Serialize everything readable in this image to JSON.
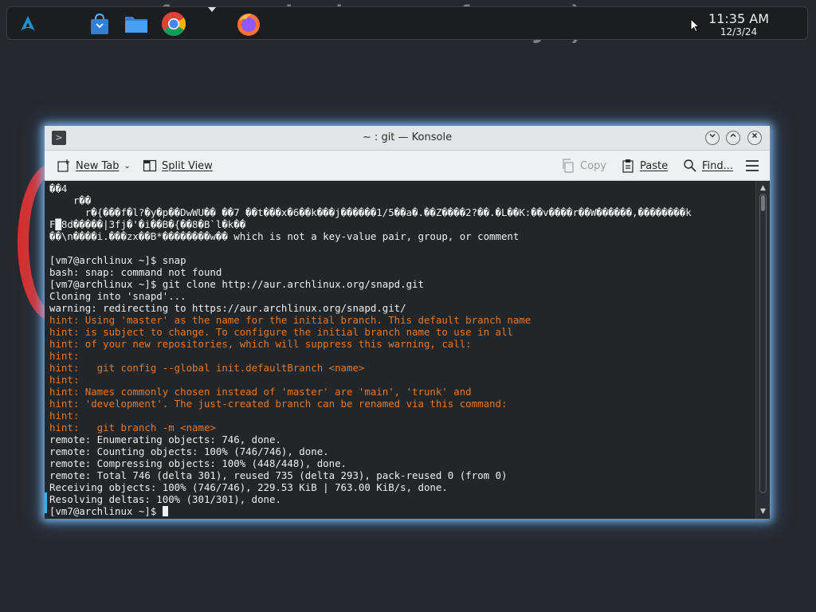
{
  "wallpaper": {
    "text": "fun noob vietnam funny :)"
  },
  "taskbar": {
    "launcher_icon": "arch-logo-icon",
    "tasks": [
      {
        "name": "Discover",
        "icon": "discover-store-icon"
      },
      {
        "name": "Dolphin",
        "icon": "folder-icon"
      },
      {
        "name": "Google Chrome",
        "icon": "chrome-icon"
      },
      {
        "name": "Firefox",
        "icon": "firefox-icon"
      }
    ],
    "clock": {
      "time": "11:35 AM",
      "date": "12/3/24"
    }
  },
  "window": {
    "title": "~ : git — Konsole",
    "buttons": [
      "minimize",
      "maximize",
      "close"
    ]
  },
  "toolbar": {
    "new_tab": "New Tab",
    "split_view": "Split View",
    "copy": "Copy",
    "paste": "Paste",
    "find": "Find..."
  },
  "terminal": {
    "lines": [
      {
        "text": "��4",
        "kind": "normal"
      },
      {
        "text": "    r��",
        "kind": "normal"
      },
      {
        "text": "      r�{���f�l?�y�p��DwWU�� ��7 ��t���x�6��k���j������1/5��a�.��Z����2?��.�L��K:��v����r��W������,��������k",
        "kind": "normal"
      },
      {
        "text": "F█8d�����|3fj�'�i��B�{��8�B`l�k��",
        "kind": "normal"
      },
      {
        "text": "��\\n����i.���zx��B*��������w�� which is not a key-value pair, group, or comment",
        "kind": "normal"
      },
      {
        "text": "",
        "kind": "normal"
      },
      {
        "text": "[vm7@archlinux ~]$ snap",
        "kind": "normal"
      },
      {
        "text": "bash: snap: command not found",
        "kind": "normal"
      },
      {
        "text": "[vm7@archlinux ~]$ git clone http://aur.archlinux.org/snapd.git",
        "kind": "normal"
      },
      {
        "text": "Cloning into 'snapd'...",
        "kind": "normal"
      },
      {
        "text": "warning: redirecting to https://aur.archlinux.org/snapd.git/",
        "kind": "normal"
      },
      {
        "text": "hint: Using 'master' as the name for the initial branch. This default branch name",
        "kind": "hint"
      },
      {
        "text": "hint: is subject to change. To configure the initial branch name to use in all",
        "kind": "hint"
      },
      {
        "text": "hint: of your new repositories, which will suppress this warning, call:",
        "kind": "hint"
      },
      {
        "text": "hint:",
        "kind": "hint"
      },
      {
        "text": "hint:   git config --global init.defaultBranch <name>",
        "kind": "hint"
      },
      {
        "text": "hint:",
        "kind": "hint"
      },
      {
        "text": "hint: Names commonly chosen instead of 'master' are 'main', 'trunk' and",
        "kind": "hint"
      },
      {
        "text": "hint: 'development'. The just-created branch can be renamed via this command:",
        "kind": "hint"
      },
      {
        "text": "hint:",
        "kind": "hint"
      },
      {
        "text": "hint:   git branch -m <name>",
        "kind": "hint"
      },
      {
        "text": "remote: Enumerating objects: 746, done.",
        "kind": "normal"
      },
      {
        "text": "remote: Counting objects: 100% (746/746), done.",
        "kind": "normal"
      },
      {
        "text": "remote: Compressing objects: 100% (448/448), done.",
        "kind": "normal"
      },
      {
        "text": "remote: Total 746 (delta 301), reused 735 (delta 293), pack-reused 0 (from 0)",
        "kind": "normal"
      },
      {
        "text": "Receiving objects: 100% (746/746), 229.53 KiB | 763.00 KiB/s, done.",
        "kind": "normal"
      },
      {
        "text": "Resolving deltas: 100% (301/301), done.",
        "kind": "normal"
      }
    ],
    "prompt": "[vm7@archlinux ~]$ ",
    "colors": {
      "background": "#232629",
      "text": "#eff0f1",
      "hint": "#e07a2b"
    }
  },
  "colors": {
    "window_glow": "#87c8ff",
    "accent": "#3daee9"
  }
}
